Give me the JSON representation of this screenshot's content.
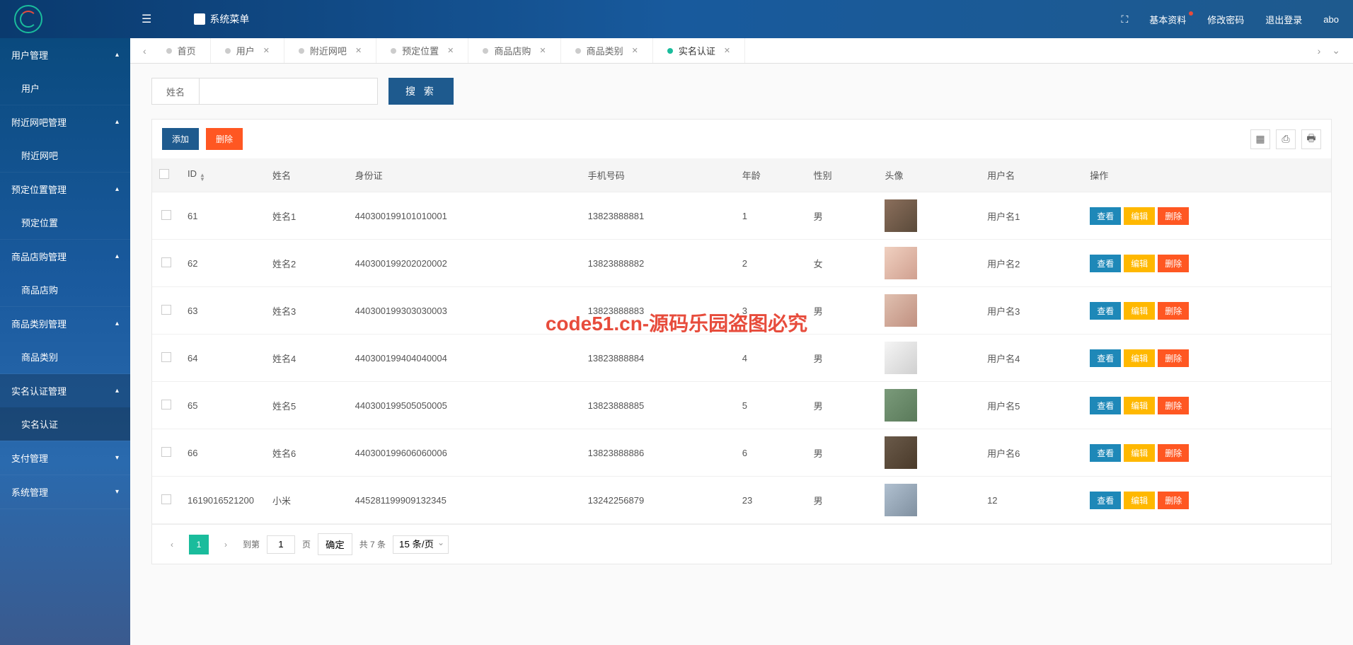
{
  "header": {
    "system_menu": "系统菜单",
    "basic_info": "基本资料",
    "change_password": "修改密码",
    "logout": "退出登录",
    "username": "abo"
  },
  "sidebar": {
    "groups": [
      {
        "label": "用户管理",
        "expanded": true,
        "items": [
          {
            "label": "用户"
          }
        ]
      },
      {
        "label": "附近网吧管理",
        "expanded": true,
        "items": [
          {
            "label": "附近网吧"
          }
        ]
      },
      {
        "label": "预定位置管理",
        "expanded": true,
        "items": [
          {
            "label": "预定位置"
          }
        ]
      },
      {
        "label": "商品店购管理",
        "expanded": true,
        "items": [
          {
            "label": "商品店购"
          }
        ]
      },
      {
        "label": "商品类别管理",
        "expanded": true,
        "items": [
          {
            "label": "商品类别"
          }
        ]
      },
      {
        "label": "实名认证管理",
        "expanded": true,
        "active": true,
        "items": [
          {
            "label": "实名认证",
            "active": true
          }
        ]
      },
      {
        "label": "支付管理",
        "expanded": false
      },
      {
        "label": "系统管理",
        "expanded": false
      }
    ]
  },
  "tabs": [
    {
      "label": "首页",
      "closable": false
    },
    {
      "label": "用户",
      "closable": true
    },
    {
      "label": "附近网吧",
      "closable": true
    },
    {
      "label": "预定位置",
      "closable": true
    },
    {
      "label": "商品店购",
      "closable": true
    },
    {
      "label": "商品类别",
      "closable": true
    },
    {
      "label": "实名认证",
      "closable": true,
      "active": true
    }
  ],
  "search": {
    "label": "姓名",
    "placeholder": "",
    "button": "搜 索"
  },
  "toolbar": {
    "add": "添加",
    "delete": "删除"
  },
  "table": {
    "columns": [
      "ID",
      "姓名",
      "身份证",
      "手机号码",
      "年龄",
      "性别",
      "头像",
      "用户名",
      "操作"
    ],
    "rows": [
      {
        "id": "61",
        "name": "姓名1",
        "idcard": "440300199101010001",
        "phone": "13823888881",
        "age": "1",
        "gender": "男",
        "avatar": "a1",
        "username": "用户名1"
      },
      {
        "id": "62",
        "name": "姓名2",
        "idcard": "440300199202020002",
        "phone": "13823888882",
        "age": "2",
        "gender": "女",
        "avatar": "a2",
        "username": "用户名2"
      },
      {
        "id": "63",
        "name": "姓名3",
        "idcard": "440300199303030003",
        "phone": "13823888883",
        "age": "3",
        "gender": "男",
        "avatar": "a3",
        "username": "用户名3"
      },
      {
        "id": "64",
        "name": "姓名4",
        "idcard": "440300199404040004",
        "phone": "13823888884",
        "age": "4",
        "gender": "男",
        "avatar": "a4",
        "username": "用户名4"
      },
      {
        "id": "65",
        "name": "姓名5",
        "idcard": "440300199505050005",
        "phone": "13823888885",
        "age": "5",
        "gender": "男",
        "avatar": "a5",
        "username": "用户名5"
      },
      {
        "id": "66",
        "name": "姓名6",
        "idcard": "440300199606060006",
        "phone": "13823888886",
        "age": "6",
        "gender": "男",
        "avatar": "a6",
        "username": "用户名6"
      },
      {
        "id": "1619016521200",
        "name": "小米",
        "idcard": "445281199909132345",
        "phone": "13242256879",
        "age": "23",
        "gender": "男",
        "avatar": "a7",
        "username": "12"
      }
    ],
    "actions": {
      "view": "查看",
      "edit": "编辑",
      "delete": "删除"
    }
  },
  "pagination": {
    "current": "1",
    "goto_label": "到第",
    "page_label": "页",
    "confirm": "确定",
    "total": "共 7 条",
    "page_size": "15 条/页"
  },
  "watermark": "code51.cn-源码乐园盗图必究"
}
